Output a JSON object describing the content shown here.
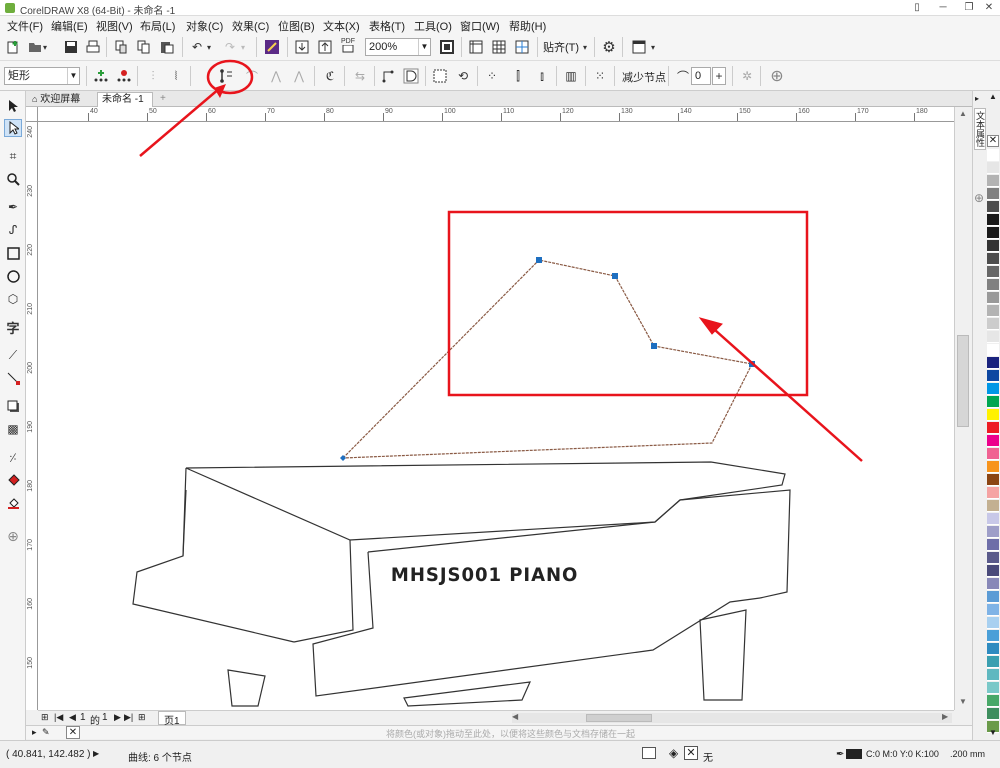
{
  "window": {
    "title": "CorelDRAW X8 (64-Bit) - 未命名 -1"
  },
  "menu": [
    "文件(F)",
    "编辑(E)",
    "视图(V)",
    "布局(L)",
    "对象(C)",
    "效果(C)",
    "位图(B)",
    "文本(X)",
    "表格(T)",
    "工具(O)",
    "窗口(W)",
    "帮助(H)"
  ],
  "toolbar": {
    "zoom": "200%",
    "snap": "贴齐(T)",
    "pdf": "PDF"
  },
  "property_bar": {
    "shape_select": "矩形",
    "reduce_nodes": "减少节点",
    "smoothness": "0"
  },
  "tabs": {
    "welcome": "欢迎屏幕",
    "document": "未命名 -1"
  },
  "ruler": {
    "h": [
      "40",
      "50",
      "60",
      "70",
      "80",
      "90",
      "100",
      "110",
      "120",
      "130",
      "140",
      "150",
      "160",
      "170",
      "180"
    ],
    "v": [
      "240",
      "230",
      "220",
      "210",
      "200",
      "190",
      "180",
      "170",
      "160",
      "150"
    ]
  },
  "canvas": {
    "logo_text": "MHSJS001 PIANO"
  },
  "page_nav": {
    "current": "1",
    "of": "的",
    "total": "1",
    "page_tab": "页1"
  },
  "hint": "将颜色(或对象)拖动至此处，以便将这些颜色与文档存储在一起",
  "status": {
    "coords": "( 40.841, 142.482 )",
    "object_info": "曲线: 6 个节点",
    "fill_none": "无",
    "outline": "C:0 M:0 Y:0 K:100",
    "width": ".200 mm"
  },
  "docker": {
    "label": "文本属性"
  },
  "colors": {
    "red_annotation": "#e8141c",
    "node": "#1e6fc0",
    "curve": "#8a5a44"
  },
  "palette": [
    "#ffffff",
    "#e6e6e6",
    "#b3b3b3",
    "#808080",
    "#4d4d4d",
    "#1a1a1a",
    "#1a1a1a",
    "#333333",
    "#4d4d4d",
    "#666666",
    "#808080",
    "#999999",
    "#b3b3b3",
    "#cccccc",
    "#e6e6e6",
    "#ffffff",
    "#1a237e",
    "#0d47a1",
    "#0097e6",
    "#00a651",
    "#fff200",
    "#ed1c24",
    "#ec008c",
    "#f06292",
    "#f7941d",
    "#8b4513",
    "#f5a3a3",
    "#c3b091",
    "#c8c8e8",
    "#9e9ec8",
    "#6e6ea8",
    "#5a5a8a",
    "#4a4a7a",
    "#8888b8",
    "#5b9bd5",
    "#7fb3e6",
    "#a8d0f0",
    "#4a9fd8",
    "#2e8bc0",
    "#3a9fb0",
    "#5fb8c0",
    "#7ac8c8",
    "#48a868",
    "#3e8e5e",
    "#6a9a4a"
  ]
}
